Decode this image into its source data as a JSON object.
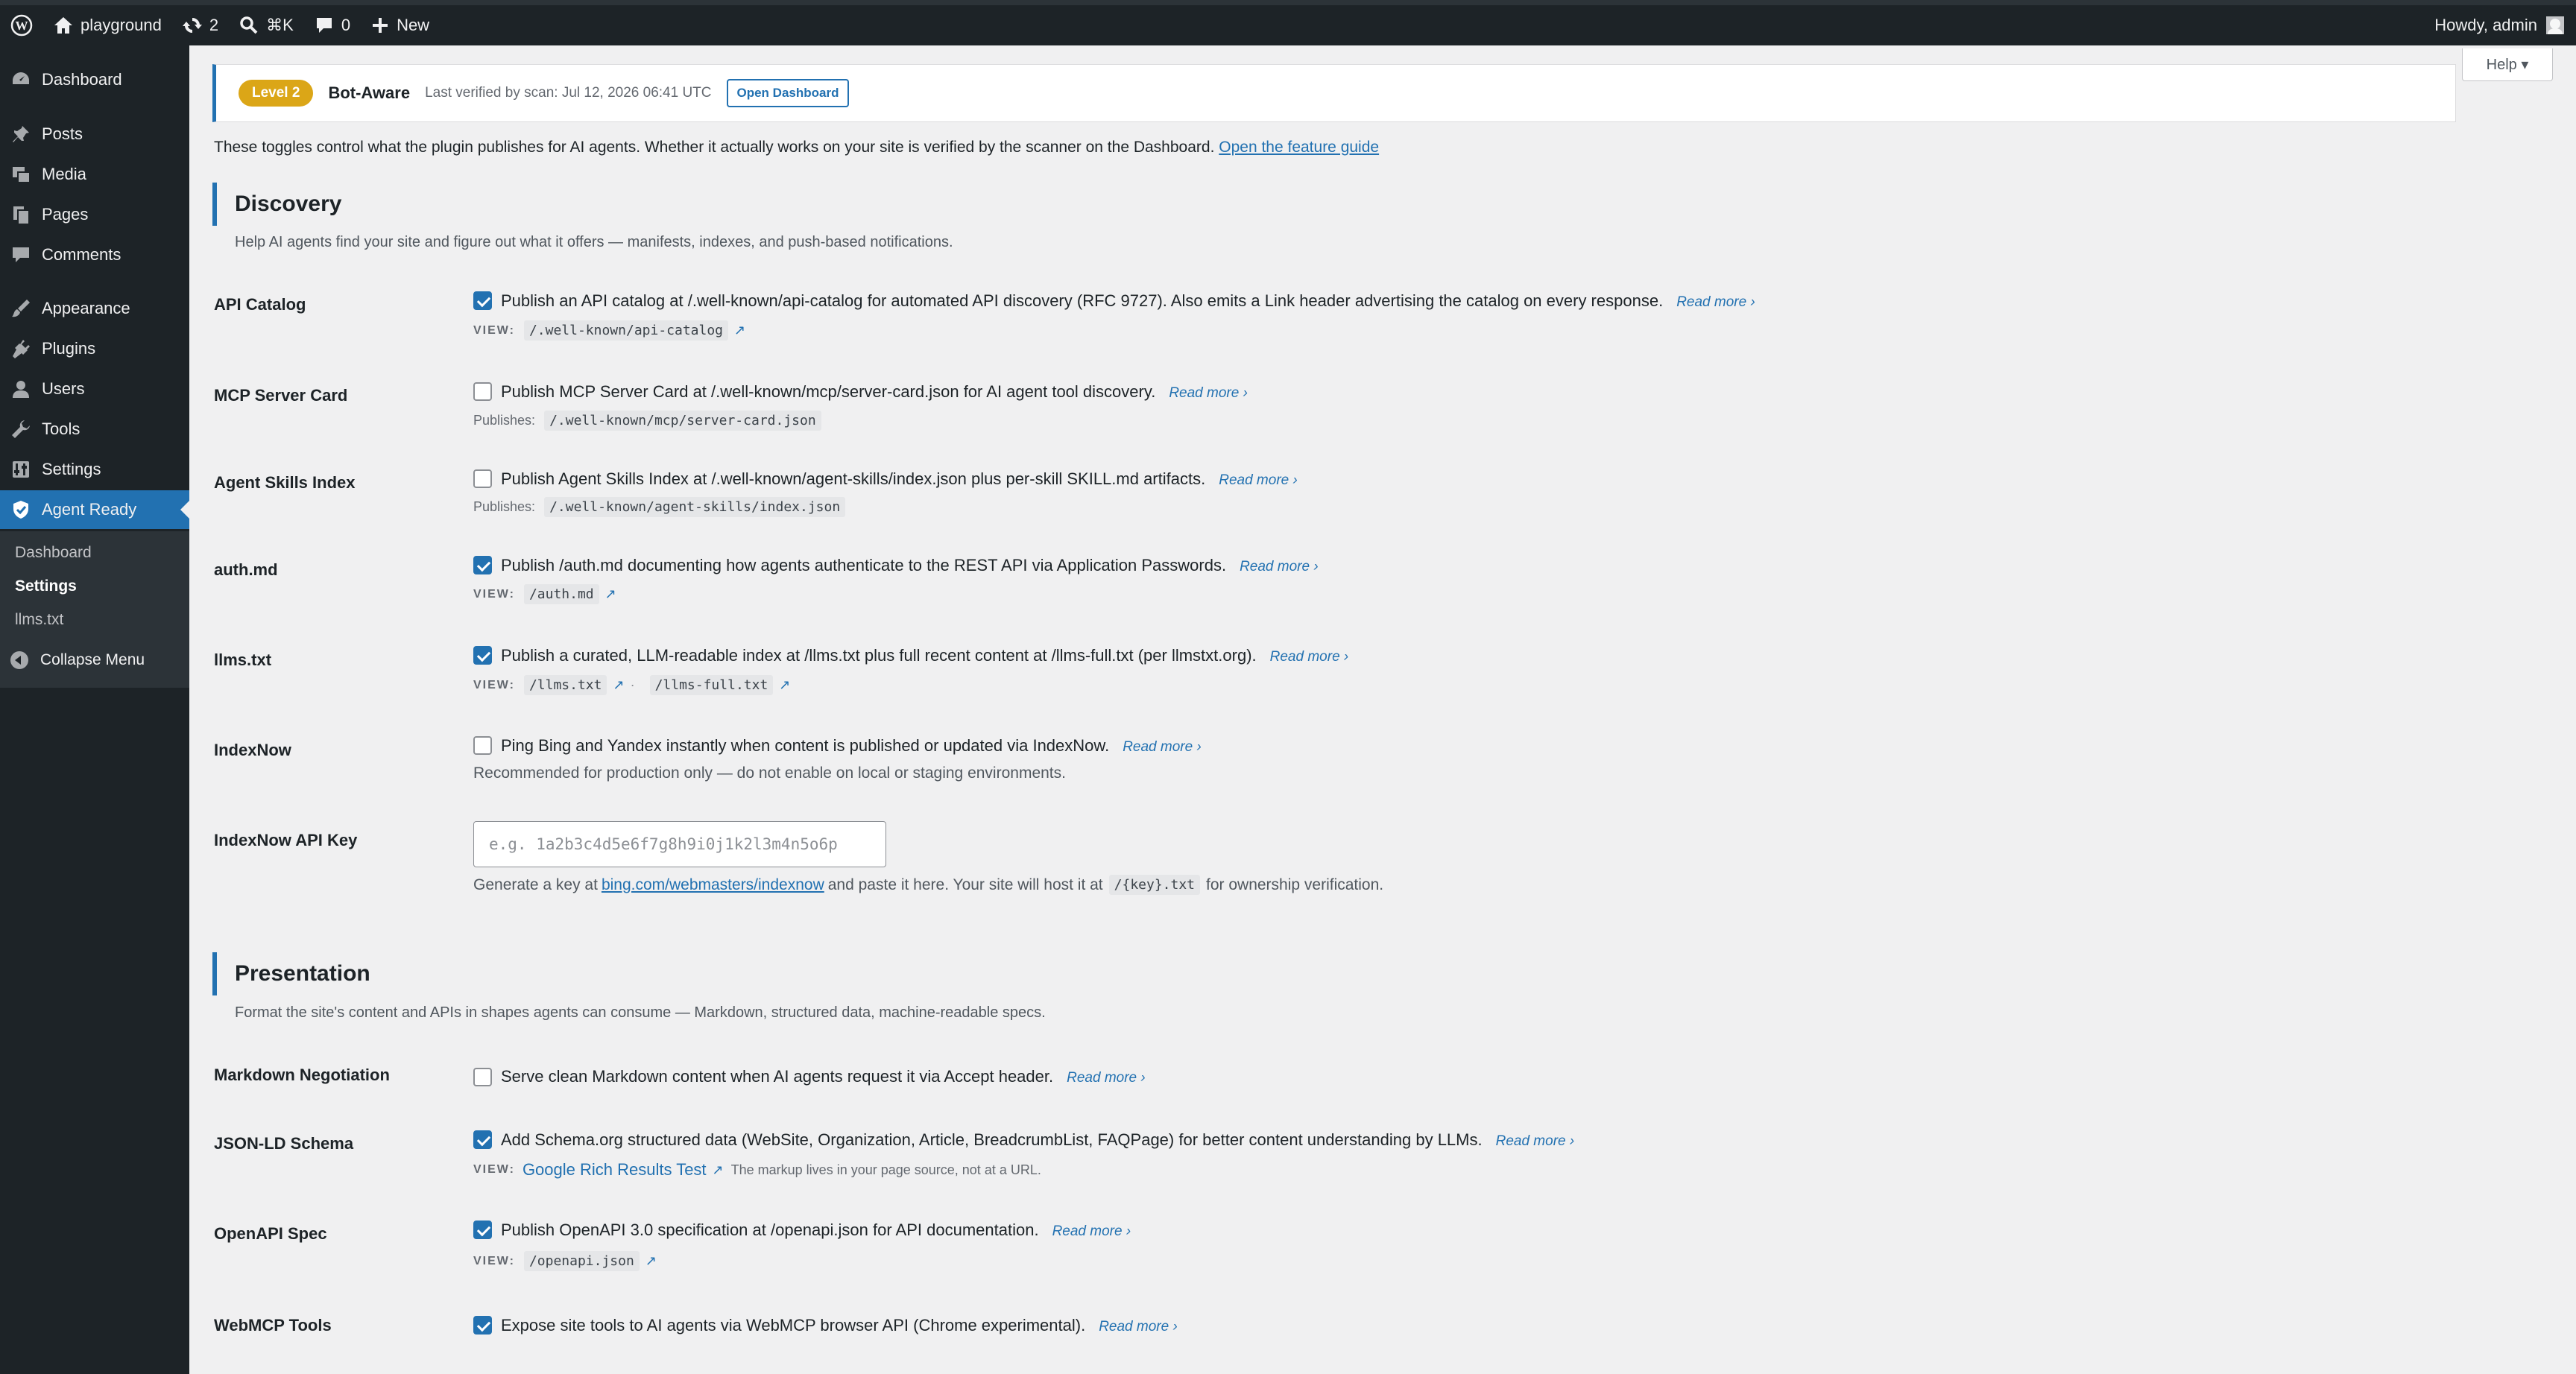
{
  "adminbar": {
    "site_name": "playground",
    "updates_count": "2",
    "search_shortcut": "⌘K",
    "comments_count": "0",
    "new_label": "New",
    "howdy": "Howdy, admin"
  },
  "sidebar": {
    "items": [
      {
        "label": "Dashboard",
        "icon": "dashboard-icon"
      },
      {
        "label": "Posts",
        "icon": "pushpin-icon"
      },
      {
        "label": "Media",
        "icon": "media-icon"
      },
      {
        "label": "Pages",
        "icon": "pages-icon"
      },
      {
        "label": "Comments",
        "icon": "comment-icon"
      },
      {
        "label": "Appearance",
        "icon": "brush-icon"
      },
      {
        "label": "Plugins",
        "icon": "plug-icon"
      },
      {
        "label": "Users",
        "icon": "user-icon"
      },
      {
        "label": "Tools",
        "icon": "wrench-icon"
      },
      {
        "label": "Settings",
        "icon": "settings-icon"
      },
      {
        "label": "Agent Ready",
        "icon": "shield-icon"
      }
    ],
    "submenu": [
      "Dashboard",
      "Settings",
      "llms.txt"
    ],
    "collapse": "Collapse Menu"
  },
  "help_label": "Help ▾",
  "level": {
    "badge": "Level 2",
    "name": "Bot-Aware",
    "verified": "Last verified by scan: Jul 12, 2026 06:41 UTC",
    "button": "Open Dashboard"
  },
  "intro": {
    "text": "These toggles control what the plugin publishes for AI agents. Whether it actually works on your site is verified by the scanner on the Dashboard.",
    "link": "Open the feature guide"
  },
  "readmore": "Read more ›",
  "view_label": "VIEW:",
  "publishes_label": "Publishes:",
  "discovery": {
    "title": "Discovery",
    "desc": "Help AI agents find your site and figure out what it offers — manifests, indexes, and push-based notifications.",
    "rows": [
      {
        "label": "API Catalog",
        "checked": true,
        "text": "Publish an API catalog at /.well-known/api-catalog for automated API discovery (RFC 9727). Also emits a Link header advertising the catalog on every response.",
        "paths": [
          "/.well-known/api-catalog"
        ]
      },
      {
        "label": "MCP Server Card",
        "checked": false,
        "text": "Publish MCP Server Card at /.well-known/mcp/server-card.json for AI agent tool discovery.",
        "paths": [
          "/.well-known/mcp/server-card.json"
        ]
      },
      {
        "label": "Agent Skills Index",
        "checked": false,
        "text": "Publish Agent Skills Index at /.well-known/agent-skills/index.json plus per-skill SKILL.md artifacts.",
        "paths": [
          "/.well-known/agent-skills/index.json"
        ]
      },
      {
        "label": "auth.md",
        "checked": true,
        "text": "Publish /auth.md documenting how agents authenticate to the REST API via Application Passwords.",
        "paths": [
          "/auth.md"
        ]
      },
      {
        "label": "llms.txt",
        "checked": true,
        "text": "Publish a curated, LLM-readable index at /llms.txt plus full recent content at /llms-full.txt (per llmstxt.org).",
        "paths": [
          "/llms.txt",
          "/llms-full.txt"
        ]
      },
      {
        "label": "IndexNow",
        "checked": false,
        "text": "Ping Bing and Yandex instantly when content is published or updated via IndexNow.",
        "note": "Recommended for production only — do not enable on local or staging environments."
      }
    ],
    "indexnow_key": {
      "label": "IndexNow API Key",
      "placeholder": "e.g. 1a2b3c4d5e6f7g8h9i0j1k2l3m4n5o6p",
      "help_pre": "Generate a key at",
      "help_link": "bing.com/webmasters/indexnow",
      "help_mid": "and paste it here. Your site will host it at",
      "help_code": "/{key}.txt",
      "help_post": "for ownership verification."
    }
  },
  "presentation": {
    "title": "Presentation",
    "desc": "Format the site's content and APIs in shapes agents can consume — Markdown, structured data, machine-readable specs.",
    "rows": [
      {
        "label": "Markdown Negotiation",
        "checked": false,
        "text": "Serve clean Markdown content when AI agents request it via Accept header."
      },
      {
        "label": "JSON-LD Schema",
        "checked": true,
        "text": "Add Schema.org structured data (WebSite, Organization, Article, BreadcrumbList, FAQPage) for better content understanding by LLMs.",
        "view_link": "Google Rich Results Test",
        "view_note": "The markup lives in your page source, not at a URL."
      },
      {
        "label": "OpenAPI Spec",
        "checked": true,
        "text": "Publish OpenAPI 3.0 specification at /openapi.json for API documentation.",
        "paths": [
          "/openapi.json"
        ]
      },
      {
        "label": "WebMCP Tools",
        "checked": true,
        "text": "Expose site tools to AI agents via WebMCP browser API (Chrome experimental)."
      }
    ]
  }
}
